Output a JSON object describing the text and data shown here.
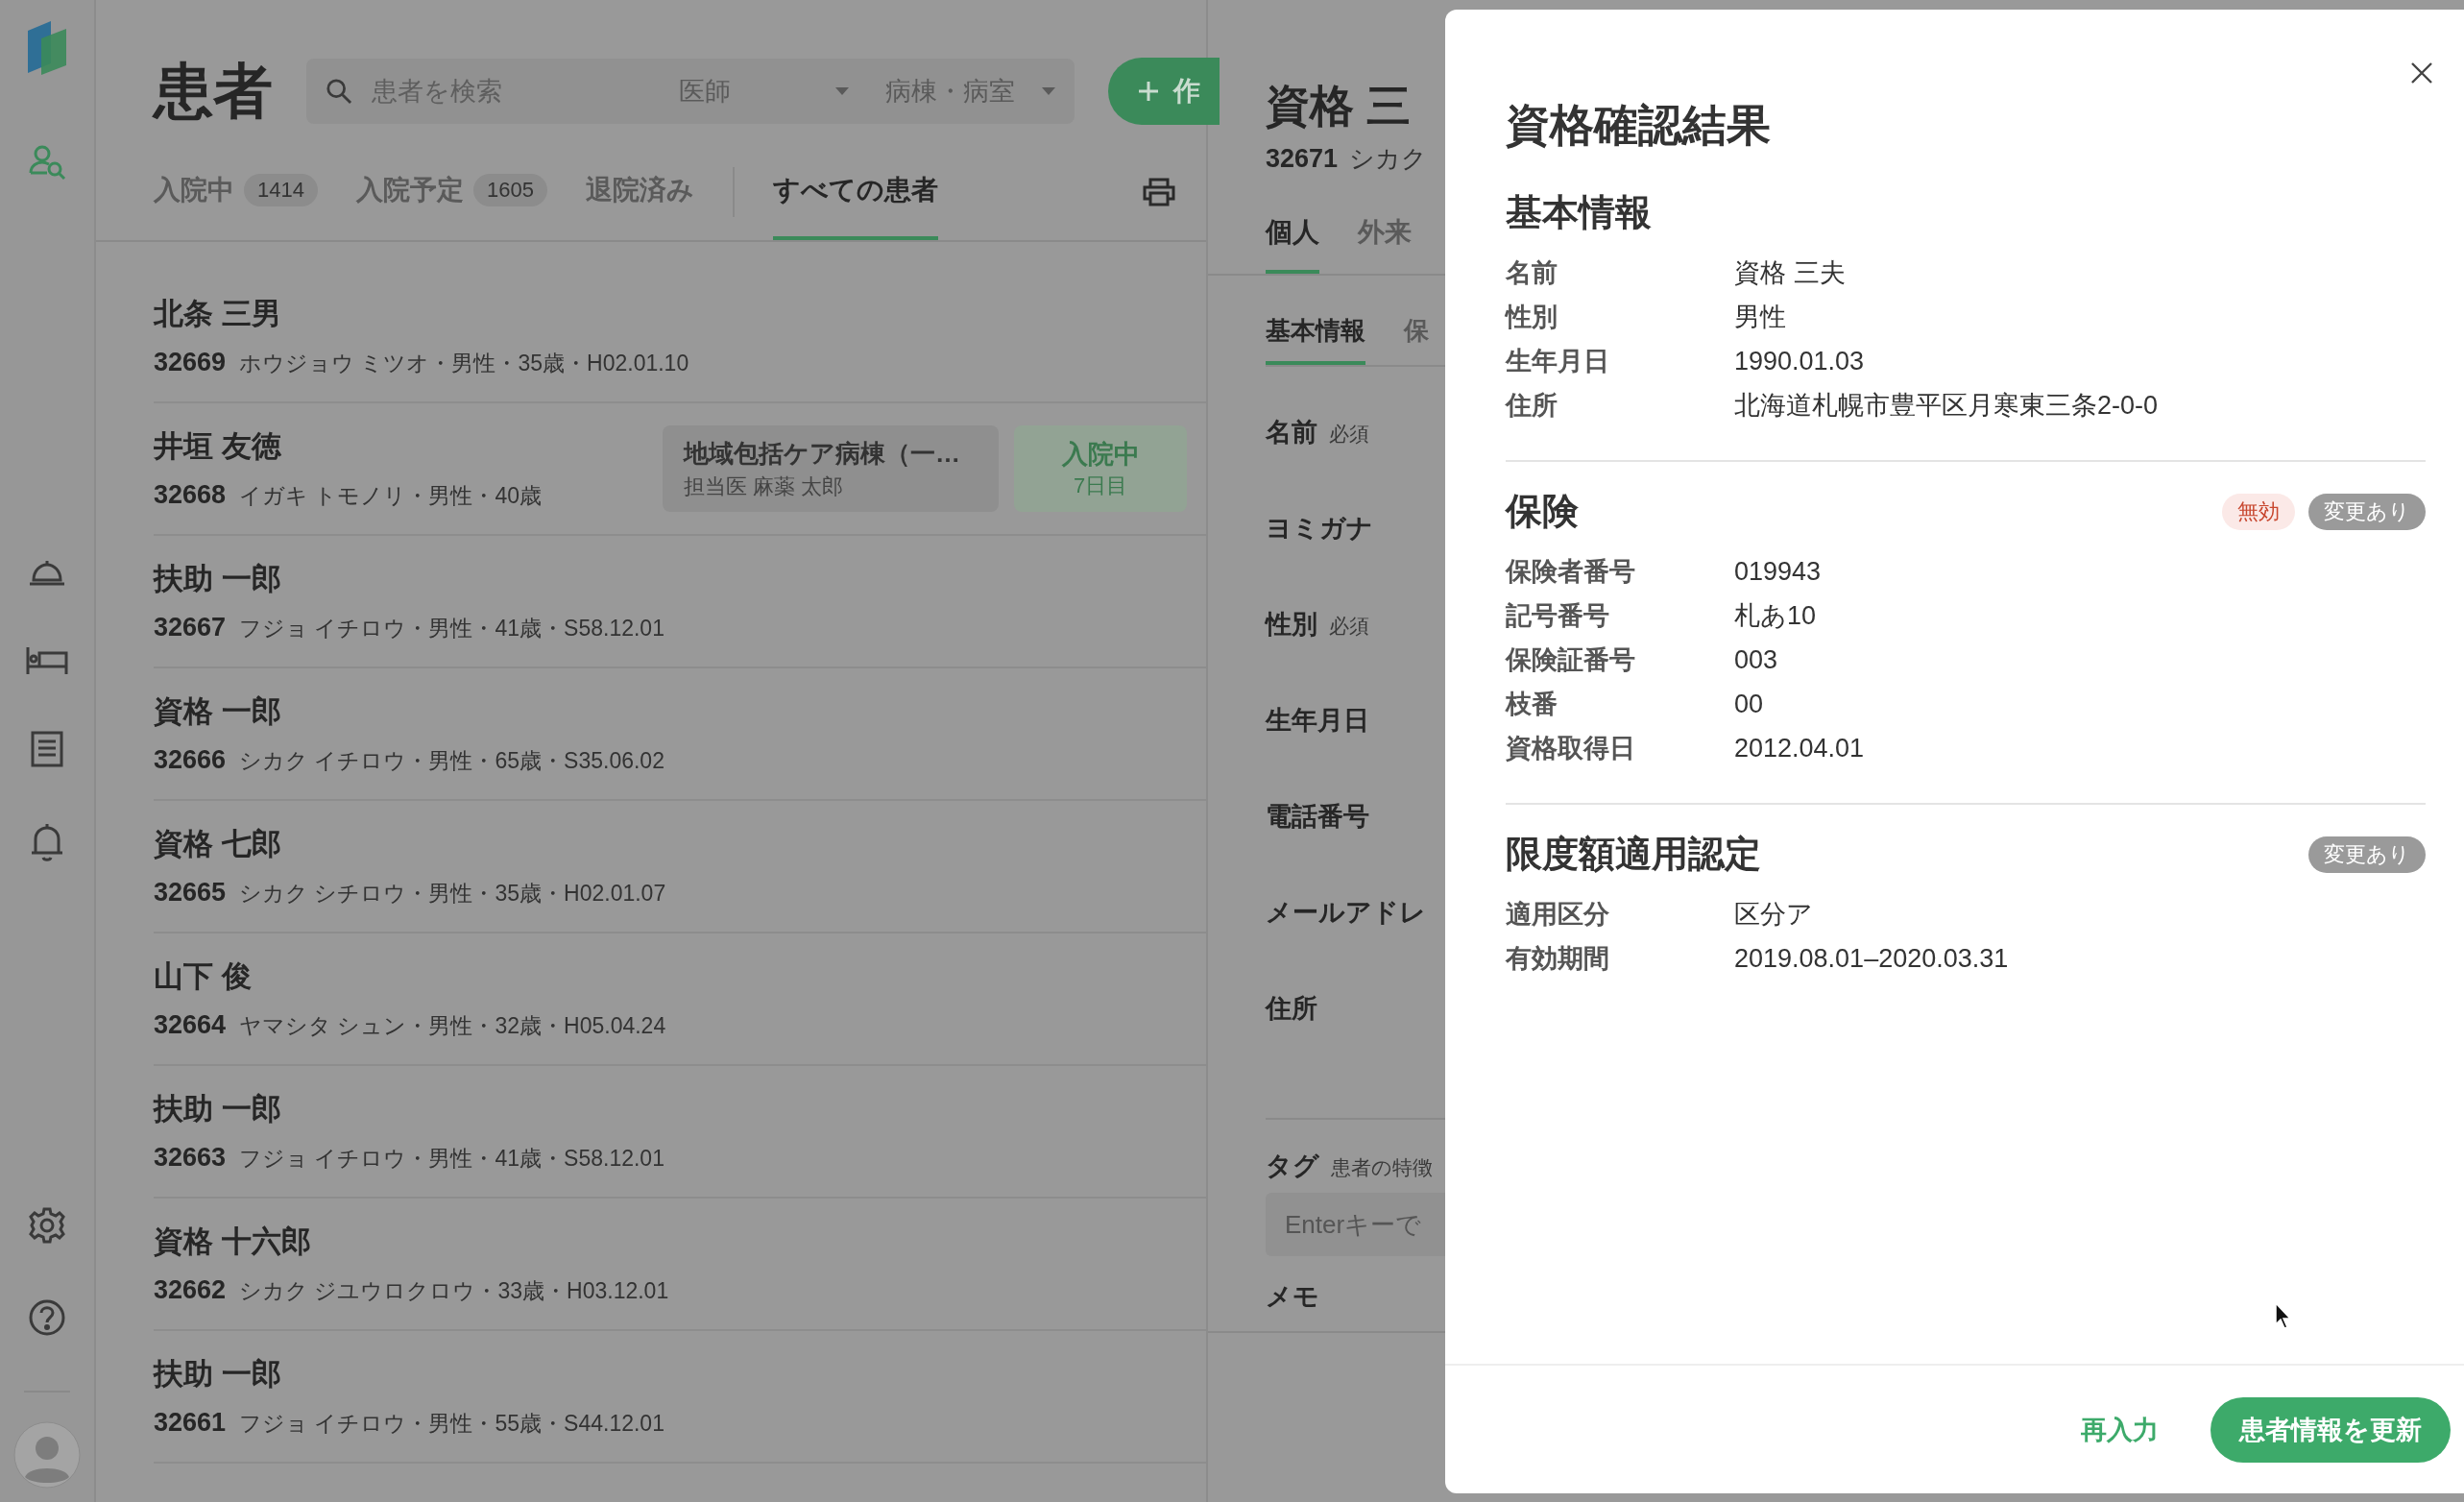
{
  "sidebar": {
    "items": [
      {
        "kind": "patients",
        "selected": true
      },
      {
        "kind": "service",
        "selected": false
      },
      {
        "kind": "bed",
        "selected": false
      },
      {
        "kind": "list",
        "selected": false
      },
      {
        "kind": "bell",
        "selected": false
      }
    ],
    "bottom_items": [
      {
        "kind": "settings"
      },
      {
        "kind": "help"
      },
      {
        "kind": "avatar"
      }
    ]
  },
  "header": {
    "title": "患者",
    "search": {
      "placeholder": "患者を検索"
    },
    "filters": [
      "医師",
      "病棟・病室"
    ],
    "create_button": "作"
  },
  "tabs": [
    {
      "label": "入院中",
      "count": "1414",
      "selected": false
    },
    {
      "label": "入院予定",
      "count": "1605",
      "selected": false
    },
    {
      "label": "退院済み",
      "selected": false
    },
    {
      "label": "すべての患者",
      "selected": true
    }
  ],
  "patients": [
    {
      "name": "北条 三男",
      "id": "32669",
      "details": "ホウジョウ ミツオ・男性・35歳・H02.01.10"
    },
    {
      "name": "井垣 友徳",
      "id": "32668",
      "details": "イガキ トモノリ・男性・40歳",
      "ward": {
        "name": "地域包括ケア病棟（一…",
        "doctor": "担当医 麻薬 太郎"
      },
      "status": {
        "label": "入院中",
        "day": "7日目"
      }
    },
    {
      "name": "扶助 一郎",
      "id": "32667",
      "details": "フジョ イチロウ・男性・41歳・S58.12.01"
    },
    {
      "name": "資格 一郎",
      "id": "32666",
      "details": "シカク イチロウ・男性・65歳・S35.06.02"
    },
    {
      "name": "資格 七郎",
      "id": "32665",
      "details": "シカク シチロウ・男性・35歳・H02.01.07"
    },
    {
      "name": "山下 俊",
      "id": "32664",
      "details": "ヤマシタ シュン・男性・32歳・H05.04.24"
    },
    {
      "name": "扶助 一郎",
      "id": "32663",
      "details": "フジョ イチロウ・男性・41歳・S58.12.01"
    },
    {
      "name": "資格 十六郎",
      "id": "32662",
      "details": "シカク ジユウロクロウ・33歳・H03.12.01"
    },
    {
      "name": "扶助 一郎",
      "id": "32661",
      "details": "フジョ イチロウ・男性・55歳・S44.12.01"
    }
  ],
  "detail": {
    "name": "資格 三",
    "id": "32671",
    "kana": "シカク",
    "tabs": [
      {
        "label": "個人",
        "selected": true
      },
      {
        "label": "外来",
        "selected": false
      }
    ],
    "subtabs": [
      {
        "label": "基本情報",
        "selected": true
      },
      {
        "label": "保",
        "selected": false
      }
    ],
    "fields": [
      {
        "label": "名前",
        "required": "必須"
      },
      {
        "label": "ヨミガナ"
      },
      {
        "label": "性別",
        "required": "必須"
      },
      {
        "label": "生年月日"
      },
      {
        "label": "電話番号"
      },
      {
        "label": "メールアドレ"
      },
      {
        "label": "住所"
      }
    ],
    "tag": {
      "label": "タグ",
      "hint": "患者の特徴"
    },
    "tag_input": {
      "placeholder": "Enterキーで"
    },
    "memo": "メモ"
  },
  "modal": {
    "title": "資格確認結果",
    "sections": [
      {
        "title": "基本情報",
        "rows": [
          {
            "label": "名前",
            "value": "資格 三夫"
          },
          {
            "label": "性別",
            "value": "男性"
          },
          {
            "label": "生年月日",
            "value": "1990.01.03"
          },
          {
            "label": "住所",
            "value": "北海道札幌市豊平区月寒東三条2-0-0"
          }
        ]
      },
      {
        "title": "保険",
        "badges": [
          {
            "label": "無効",
            "kind": "invalid"
          },
          {
            "label": "変更あり",
            "kind": "changed"
          }
        ],
        "rows": [
          {
            "label": "保険者番号",
            "value": "019943"
          },
          {
            "label": "記号番号",
            "value": "札あ10"
          },
          {
            "label": "保険証番号",
            "value": "003"
          },
          {
            "label": "枝番",
            "value": "00"
          },
          {
            "label": "資格取得日",
            "value": "2012.04.01"
          }
        ]
      },
      {
        "title": "限度額適用認定",
        "badges": [
          {
            "label": "変更あり",
            "kind": "changed"
          }
        ],
        "rows": [
          {
            "label": "適用区分",
            "value": "区分ア"
          },
          {
            "label": "有効期間",
            "value": "2019.08.01–2020.03.31"
          }
        ]
      }
    ],
    "buttons": [
      {
        "label": "再入力",
        "kind": "text"
      },
      {
        "label": "患者情報を更新",
        "kind": "primary"
      }
    ]
  }
}
